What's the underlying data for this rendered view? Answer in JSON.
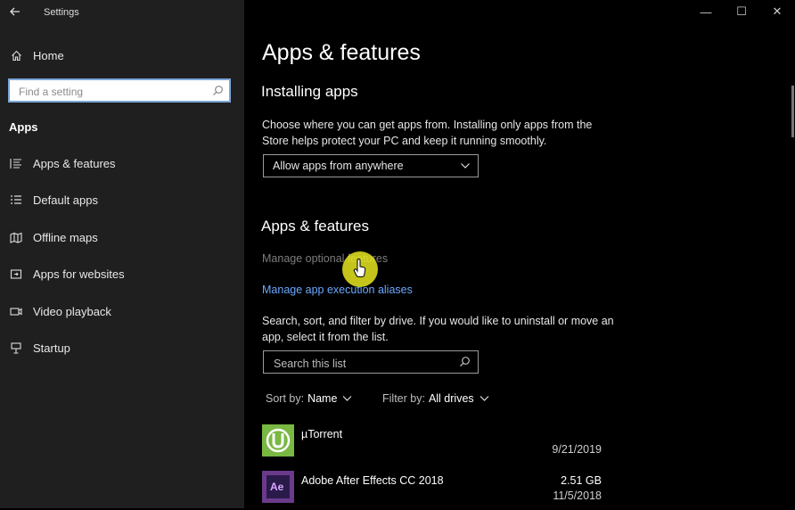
{
  "window": {
    "title": "Settings",
    "controls": {
      "minimize": "—",
      "maximize": "☐",
      "close": "✕"
    }
  },
  "sidebar": {
    "home_label": "Home",
    "search_placeholder": "Find a setting",
    "section_title": "Apps",
    "items": [
      {
        "label": "Apps & features",
        "icon": "apps-features-icon"
      },
      {
        "label": "Default apps",
        "icon": "default-apps-icon"
      },
      {
        "label": "Offline maps",
        "icon": "offline-maps-icon"
      },
      {
        "label": "Apps for websites",
        "icon": "apps-for-websites-icon"
      },
      {
        "label": "Video playback",
        "icon": "video-playback-icon"
      },
      {
        "label": "Startup",
        "icon": "startup-icon"
      }
    ]
  },
  "main": {
    "page_title": "Apps & features",
    "installing": {
      "heading": "Installing apps",
      "description": "Choose where you can get apps from. Installing only apps from the Store helps protect your PC and keep it running smoothly.",
      "dropdown_value": "Allow apps from anywhere"
    },
    "features": {
      "heading": "Apps & features",
      "manage_optional": "Manage optional features",
      "manage_aliases": "Manage app execution aliases",
      "description": "Search, sort, and filter by drive. If you would like to uninstall or move an app, select it from the list.",
      "search_placeholder": "Search this list",
      "sort_label": "Sort by:",
      "sort_value": "Name",
      "filter_label": "Filter by:",
      "filter_value": "All drives"
    },
    "apps": [
      {
        "name": "µTorrent",
        "size": "",
        "date": "9/21/2019",
        "icon": "utorrent-icon",
        "color": "#79b843"
      },
      {
        "name": "Adobe After Effects CC 2018",
        "size": "2.51 GB",
        "date": "11/5/2018",
        "icon": "after-effects-icon",
        "color": "#2a1a4a",
        "icon_text": "Ae"
      }
    ]
  },
  "colors": {
    "link": "#6aa8ff",
    "cursor_highlight": "#e6e61e",
    "sidebar_bg": "#1f1f1f"
  }
}
